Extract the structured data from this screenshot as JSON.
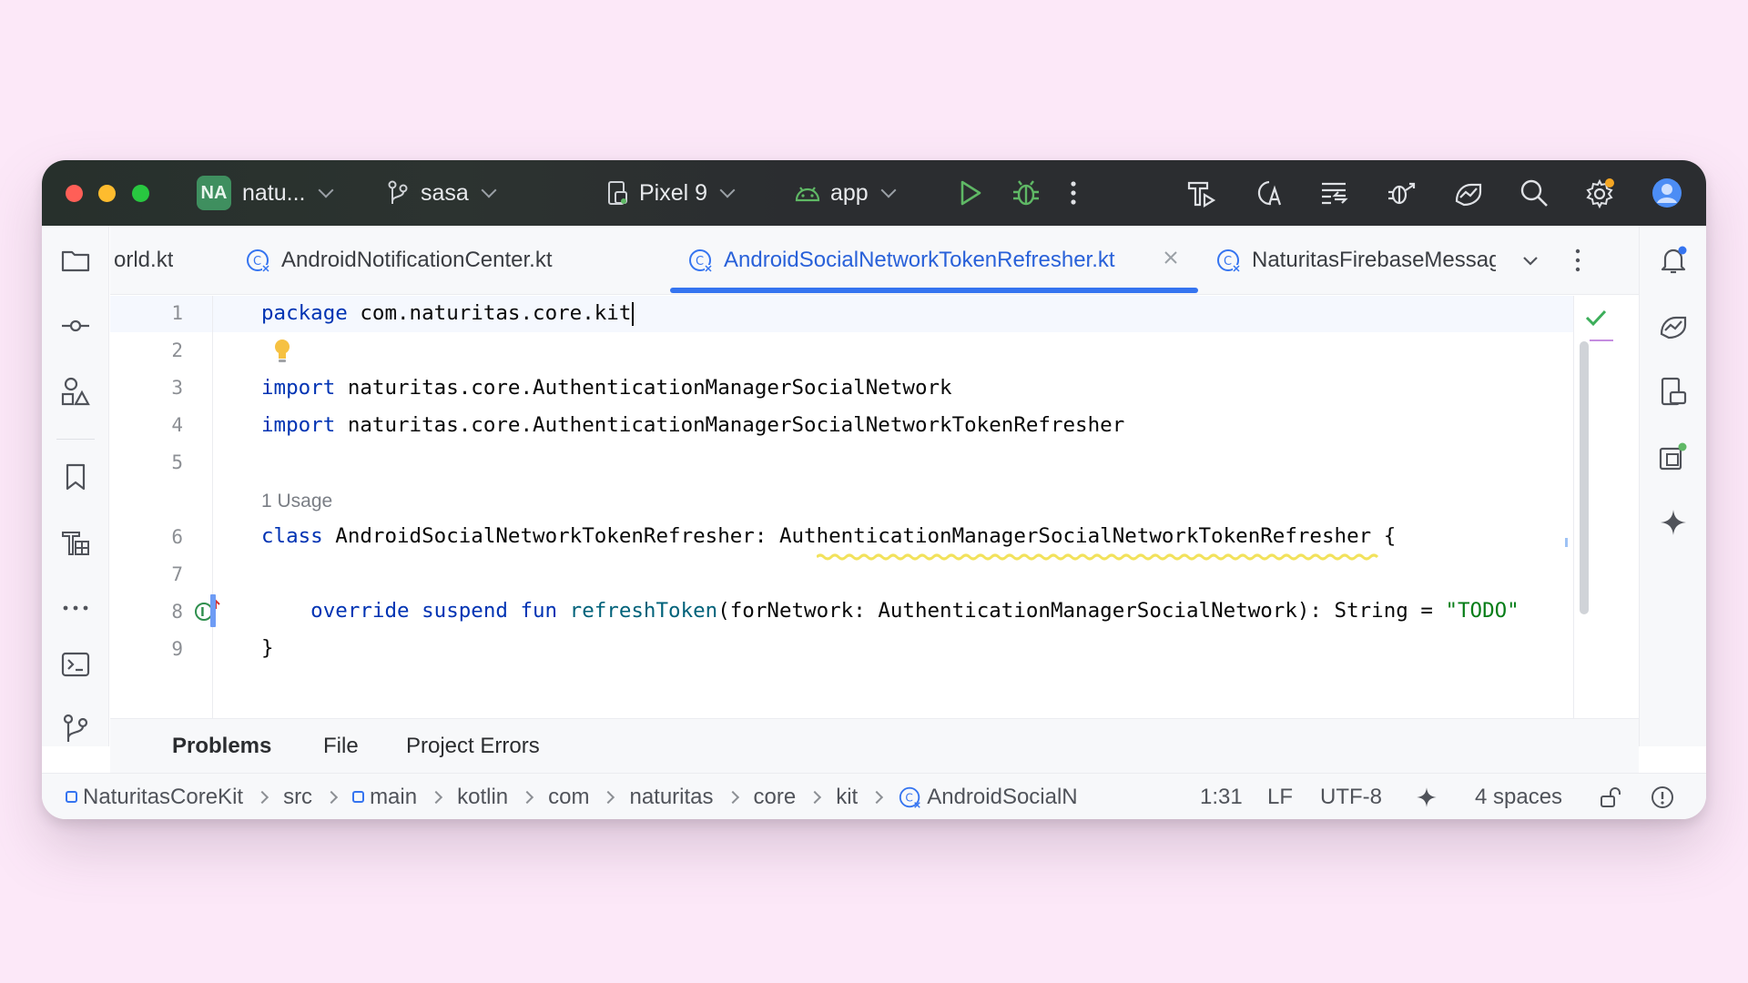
{
  "titlebar": {
    "project_badge": "NA",
    "project_name": "natu...",
    "branch": "sasa",
    "device": "Pixel 9",
    "run_config": "app"
  },
  "tabs": [
    {
      "label": "orld.kt"
    },
    {
      "label": "AndroidNotificationCenter.kt"
    },
    {
      "label": "AndroidSocialNetworkTokenRefresher.kt",
      "active": true
    },
    {
      "label": "NaturitasFirebaseMessagingSe"
    }
  ],
  "editor": {
    "line_numbers": [
      "1",
      "2",
      "3",
      "4",
      "5",
      "6",
      "7",
      "8",
      "9"
    ],
    "usage_hint": "1 Usage",
    "lines": {
      "l1_kw": "package",
      "l1_rest": " com.naturitas.core.kit",
      "l3_kw": "import",
      "l3_rest": " naturitas.core.AuthenticationManagerSocialNetwork",
      "l4_kw": "import",
      "l4_rest": " naturitas.core.AuthenticationManagerSocialNetworkTokenRefresher",
      "l6_kw": "class",
      "l6_rest": " AndroidSocialNetworkTokenRefresher: AuthenticationManagerSocialNetworkTokenRefresher {",
      "l8_kw": "    override suspend fun ",
      "l8_fn": "refreshToken",
      "l8_rest": "(forNetwork: AuthenticationManagerSocialNetwork): String = ",
      "l8_str": "\"TODO\"",
      "l9": "}"
    }
  },
  "problems_tabs": [
    "Problems",
    "File",
    "Project Errors"
  ],
  "breadcrumbs": [
    "NaturitasCoreKit",
    "src",
    "main",
    "kotlin",
    "com",
    "naturitas",
    "core",
    "kit",
    "AndroidSocialN"
  ],
  "status": {
    "position": "1:31",
    "line_ending": "LF",
    "encoding": "UTF-8",
    "indent": "4 spaces"
  },
  "colors": {
    "accent": "#3574f0",
    "keyword": "#0033b3",
    "function": "#00627a",
    "string": "#067d17"
  }
}
